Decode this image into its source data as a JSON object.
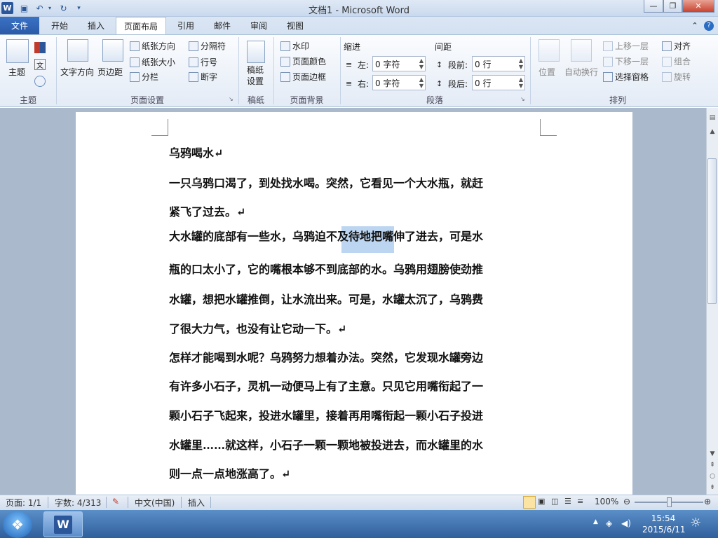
{
  "window": {
    "app_icon": "W",
    "title": "文档1 - Microsoft Word",
    "buttons": {
      "minimize": "—",
      "maximize": "❐",
      "close": "✕"
    }
  },
  "quick_access": [
    "save-icon",
    "undo-icon",
    "redo-icon",
    "customize-icon"
  ],
  "tabs": [
    "文件",
    "开始",
    "插入",
    "页面布局",
    "引用",
    "邮件",
    "审阅",
    "视图"
  ],
  "ribbon": {
    "themes": {
      "label": "主题",
      "button": "主题"
    },
    "page_setup": {
      "label": "页面设置",
      "text_direction": "文字方向",
      "margins": "页边距",
      "orientation": "纸张方向",
      "size": "纸张大小",
      "columns": "分栏",
      "breaks": "分隔符",
      "line_numbers": "行号",
      "hyphenation": "断字"
    },
    "manuscript": {
      "label": "稿纸",
      "button_line1": "稿纸",
      "button_line2": "设置"
    },
    "page_background": {
      "label": "页面背景",
      "watermark": "水印",
      "page_color": "页面颜色",
      "page_border": "页面边框"
    },
    "paragraph": {
      "label": "段落",
      "indent_title": "缩进",
      "spacing_title": "间距",
      "left_label": "左:",
      "left_value": "0 字符",
      "right_label": "右:",
      "right_value": "0 字符",
      "before_label": "段前:",
      "before_value": "0 行",
      "after_label": "段后:",
      "after_value": "0 行"
    },
    "arrange": {
      "label": "排列",
      "position": "位置",
      "wrap": "自动换行",
      "bring_forward": "上移一层",
      "send_backward": "下移一层",
      "selection_pane": "选择窗格",
      "align": "对齐",
      "group": "组合",
      "rotate": "旋转"
    }
  },
  "document": {
    "lines": [
      "乌鸦喝水↵",
      "一只乌鸦口渴了，到处找水喝。突然，它看见一个大水瓶，就赶",
      "紧飞了过去。↵",
      "大水罐的底部有一些水，乌鸦迫不及待地把嘴伸了进去，可是水",
      "瓶的口太小了，它的嘴根本够不到底部的水。乌鸦用翅膀使劲推",
      "水罐，想把水罐推倒，让水流出来。可是，水罐太沉了，乌鸦费",
      "了很大力气，也没有让它动一下。↵",
      "怎样才能喝到水呢？乌鸦努力想着办法。突然，它发现水罐旁边",
      "有许多小石子，灵机一动便马上有了主意。只见它用嘴衔起了一",
      "颗小石子飞起来，投进水罐里，接着再用嘴衔起一颗小石子投进",
      "水罐里……就这样，小石子一颗一颗地被投进去，而水罐里的水",
      "则一点一点地涨高了。↵"
    ],
    "selected_text": "迫不及待"
  },
  "status": {
    "page": "页面: 1/1",
    "words": "字数: 4/313",
    "language": "中文(中国)",
    "mode": "插入",
    "zoom": "100%"
  },
  "taskbar": {
    "time": "15:54",
    "date": "2015/6/11"
  },
  "colors": {
    "accent": "#2b579a",
    "selection": "#bcd5f0"
  }
}
